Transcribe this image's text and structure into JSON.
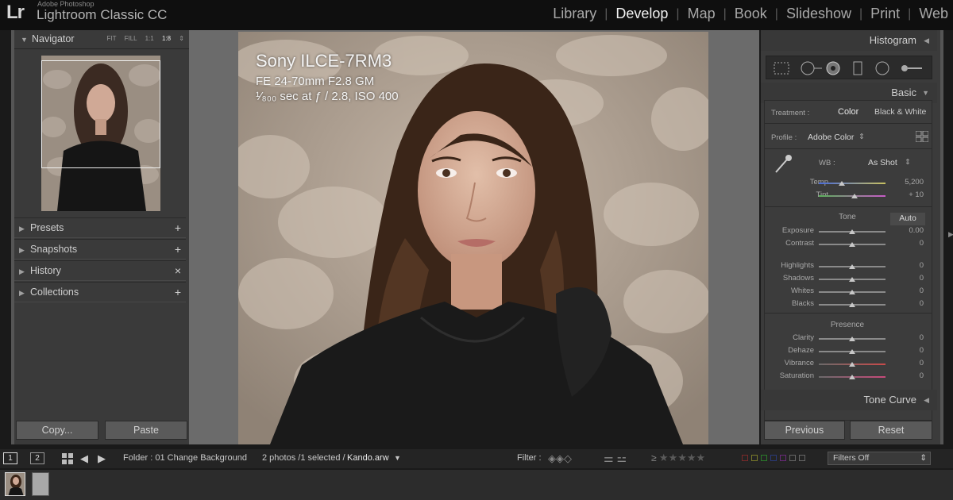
{
  "app": {
    "logo": "Lr",
    "brand_small": "Adobe Photoshop",
    "brand_big": "Lightroom Classic CC"
  },
  "modules": [
    "Library",
    "Develop",
    "Map",
    "Book",
    "Slideshow",
    "Print",
    "Web"
  ],
  "active_module": "Develop",
  "navigator": {
    "title": "Navigator",
    "zoom": [
      "FIT",
      "FILL",
      "1:1",
      "1:8"
    ],
    "selected_zoom": "1:8"
  },
  "left_sections": [
    {
      "label": "Presets",
      "action": "+"
    },
    {
      "label": "Snapshots",
      "action": "+"
    },
    {
      "label": "History",
      "action": "×"
    },
    {
      "label": "Collections",
      "action": "+"
    }
  ],
  "left_buttons": {
    "copy": "Copy...",
    "paste": "Paste"
  },
  "info_overlay": {
    "model": "Sony ILCE-7RM3",
    "lens": "FE 24-70mm F2.8 GM",
    "exposure": "¹⁄₈₀₀ sec at ƒ / 2.8, ISO 400"
  },
  "right": {
    "histogram": "Histogram",
    "basic": "Basic",
    "treatment_label": "Treatment :",
    "treatment_color": "Color",
    "treatment_bw": "Black & White",
    "profile_label": "Profile :",
    "profile_value": "Adobe Color",
    "wb_label": "WB :",
    "wb_value": "As Shot",
    "temp_label": "Temp",
    "temp_value": "5,200",
    "tint_label": "Tint",
    "tint_value": "+ 10",
    "tone_label": "Tone",
    "auto": "Auto",
    "sliders": [
      {
        "label": "Exposure",
        "value": "0.00"
      },
      {
        "label": "Contrast",
        "value": "0"
      },
      {
        "label": "Highlights",
        "value": "0"
      },
      {
        "label": "Shadows",
        "value": "0"
      },
      {
        "label": "Whites",
        "value": "0"
      },
      {
        "label": "Blacks",
        "value": "0"
      }
    ],
    "presence_label": "Presence",
    "presence": [
      {
        "label": "Clarity",
        "value": "0"
      },
      {
        "label": "Dehaze",
        "value": "0"
      },
      {
        "label": "Vibrance",
        "value": "0"
      },
      {
        "label": "Saturation",
        "value": "0"
      }
    ],
    "tone_curve": "Tone Curve",
    "previous": "Previous",
    "reset": "Reset"
  },
  "filmbar": {
    "screen1": "1",
    "screen2": "2",
    "folder": "Folder : 01 Change Background",
    "count": "2 photos /1 selected /",
    "filename": "Kando.arw",
    "filter_label": "Filter :",
    "filters_off": "Filters Off"
  },
  "colors": {
    "accent": "#f2f2f2",
    "panel": "#3b3b3b",
    "bg": "#6b6b6b"
  }
}
